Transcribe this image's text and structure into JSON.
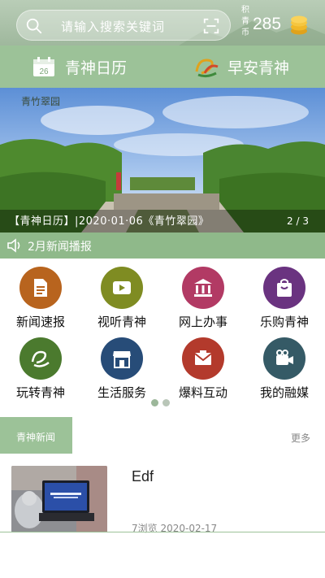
{
  "header": {
    "search_placeholder": "请输入搜索关键词",
    "points_label": "积青币",
    "points_value": "285"
  },
  "quick_tabs": [
    {
      "label": "青神日历",
      "icon": "calendar-icon",
      "calendar_day": "26"
    },
    {
      "label": "早安青神",
      "icon": "qingshen-logo-icon"
    }
  ],
  "banner": {
    "corner_text": "青竹翠园",
    "caption": "【青神日历】|2020·01·06《青竹翠园》",
    "pager": "2 / 3"
  },
  "broadcast": {
    "label": "2月新闻播报"
  },
  "grid": [
    {
      "label": "新闻速报",
      "icon": "news-document-icon",
      "color": "#b8641e"
    },
    {
      "label": "视听青神",
      "icon": "video-play-icon",
      "color": "#7f8c22"
    },
    {
      "label": "网上办事",
      "icon": "government-building-icon",
      "color": "#b23a64"
    },
    {
      "label": "乐购青神",
      "icon": "shopping-bag-icon",
      "color": "#6a3380"
    },
    {
      "label": "玩转青神",
      "icon": "qingshen-logo-icon",
      "color": "#4b7a2e"
    },
    {
      "label": "生活服务",
      "icon": "storefront-icon",
      "color": "#274c78"
    },
    {
      "label": "爆料互动",
      "icon": "mail-envelope-icon",
      "color": "#b33a2c"
    },
    {
      "label": "我的融媒",
      "icon": "video-camera-icon",
      "color": "#355a66"
    }
  ],
  "section": {
    "title": "青神新闻",
    "more": "更多"
  },
  "news": [
    {
      "title": "Edf",
      "meta": "7浏览 2020-02-17"
    }
  ],
  "colors": {
    "accent_green": "#9cc298",
    "header_green": "#a9c2a6"
  }
}
